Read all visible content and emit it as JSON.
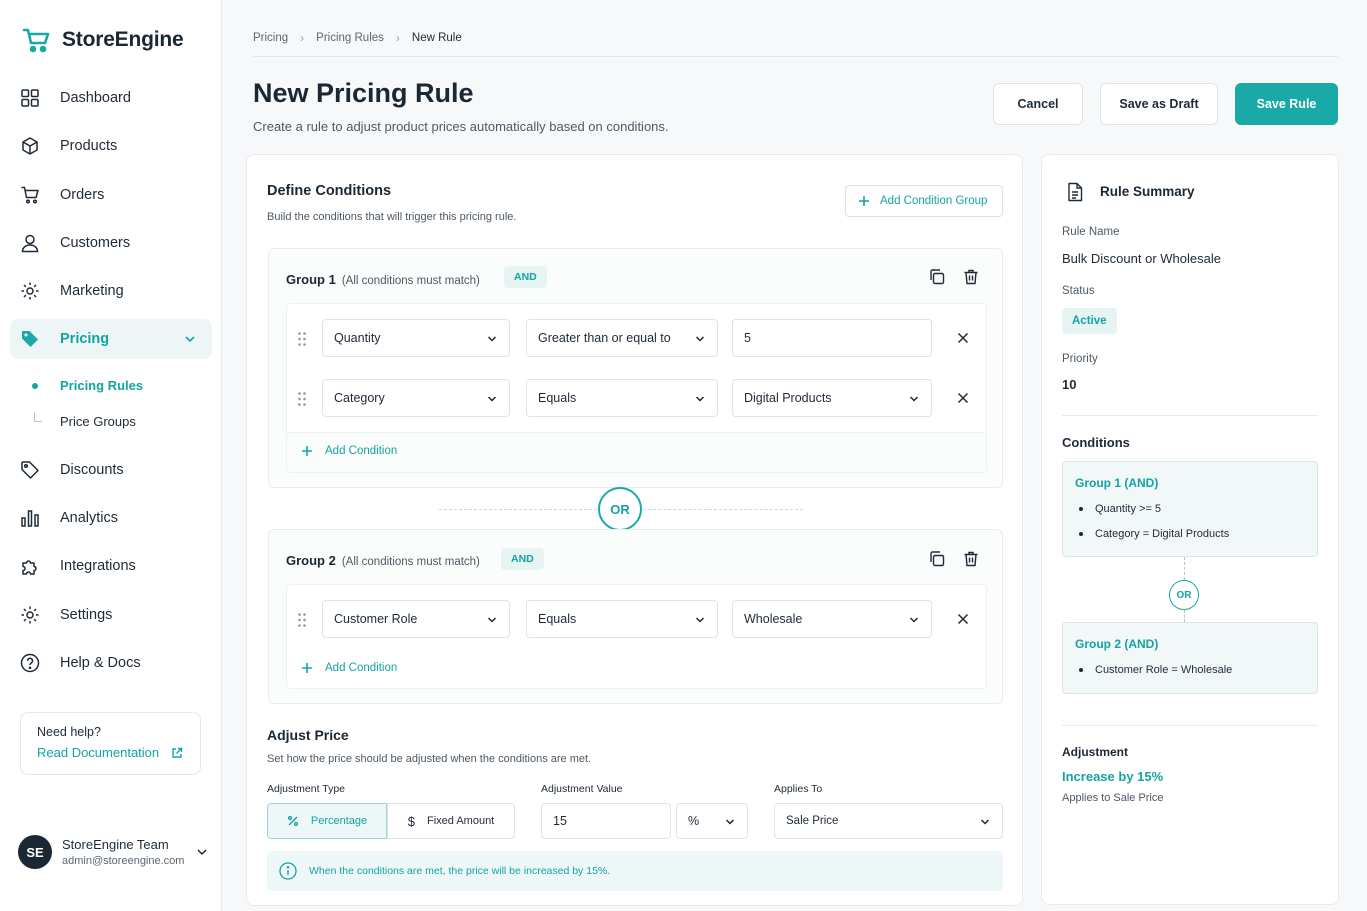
{
  "app": {
    "name": "StoreEngine"
  },
  "sidebar": {
    "items": [
      {
        "label": "Dashboard",
        "icon": "grid-icon"
      },
      {
        "label": "Products",
        "icon": "box-icon"
      },
      {
        "label": "Orders",
        "icon": "cart-icon"
      },
      {
        "label": "Customers",
        "icon": "user-icon"
      },
      {
        "label": "Marketing",
        "icon": "gear-icon"
      },
      {
        "label": "Pricing",
        "icon": "tag-icon",
        "active": true
      },
      {
        "label": "Discounts",
        "icon": "tag-outline-icon"
      },
      {
        "label": "Analytics",
        "icon": "bar-chart-icon"
      },
      {
        "label": "Integrations",
        "icon": "puzzle-icon"
      },
      {
        "label": "Settings",
        "icon": "gear-icon"
      },
      {
        "label": "Help & Docs",
        "icon": "help-circle-icon"
      }
    ],
    "subitems": [
      {
        "label": "Pricing Rules",
        "active": true
      },
      {
        "label": "Price Groups"
      }
    ],
    "help": {
      "title": "Need help?",
      "link": "Read Documentation"
    },
    "user": {
      "initials": "SE",
      "name": "StoreEngine Team",
      "email": "admin@storeengine.com"
    }
  },
  "breadcrumb": [
    "Pricing",
    "Pricing Rules",
    "New Rule"
  ],
  "header": {
    "title": "New Pricing Rule",
    "subtitle": "Create a rule to adjust product prices automatically based on conditions.",
    "cancel": "Cancel",
    "save_draft": "Save as Draft",
    "save_rule": "Save Rule"
  },
  "conditions": {
    "title": "Define Conditions",
    "subtitle": "Build the conditions that will trigger this pricing rule.",
    "add_group": "Add Condition Group",
    "or_label": "OR",
    "add_condition": "Add Condition",
    "groups": [
      {
        "title": "Group 1",
        "hint": "(All conditions must match)",
        "badge": "AND",
        "rows": [
          {
            "field": "Quantity",
            "operator": "Greater than or equal to",
            "value": "5"
          },
          {
            "field": "Category",
            "operator": "Equals",
            "value": "Digital Products"
          }
        ]
      },
      {
        "title": "Group 2",
        "hint": "(All conditions must match)",
        "badge": "AND",
        "rows": [
          {
            "field": "Customer Role",
            "operator": "Equals",
            "value": "Wholesale"
          }
        ]
      }
    ]
  },
  "adjust": {
    "title": "Adjust Price",
    "subtitle": "Set how the price should be adjusted when the conditions are met.",
    "type_label": "Adjustment Type",
    "type_percentage": "Percentage",
    "type_fixed": "Fixed Amount",
    "value_label": "Adjustment Value",
    "value": "15",
    "unit": "%",
    "applies_label": "Applies To",
    "applies": "Sale Price",
    "info": "When the conditions are met, the price will be increased by 15%."
  },
  "summary": {
    "title": "Rule Summary",
    "name_label": "Rule Name",
    "name": "Bulk Discount or Wholesale",
    "status_label": "Status",
    "status": "Active",
    "priority_label": "Priority",
    "priority": "10",
    "conditions_label": "Conditions",
    "group1_title": "Group 1 (AND)",
    "group1_items": [
      "Quantity >= 5",
      "Category = Digital Products"
    ],
    "or_label": "OR",
    "group2_title": "Group 2 (AND)",
    "group2_items": [
      "Customer Role = Wholesale"
    ],
    "adjustment_label": "Adjustment",
    "adjustment": "Increase by 15%",
    "adjustment_note": "Applies to Sale Price"
  },
  "colors": {
    "accent": "#19a9a7",
    "text": "#1f2a37",
    "border": "#e7ebef"
  }
}
